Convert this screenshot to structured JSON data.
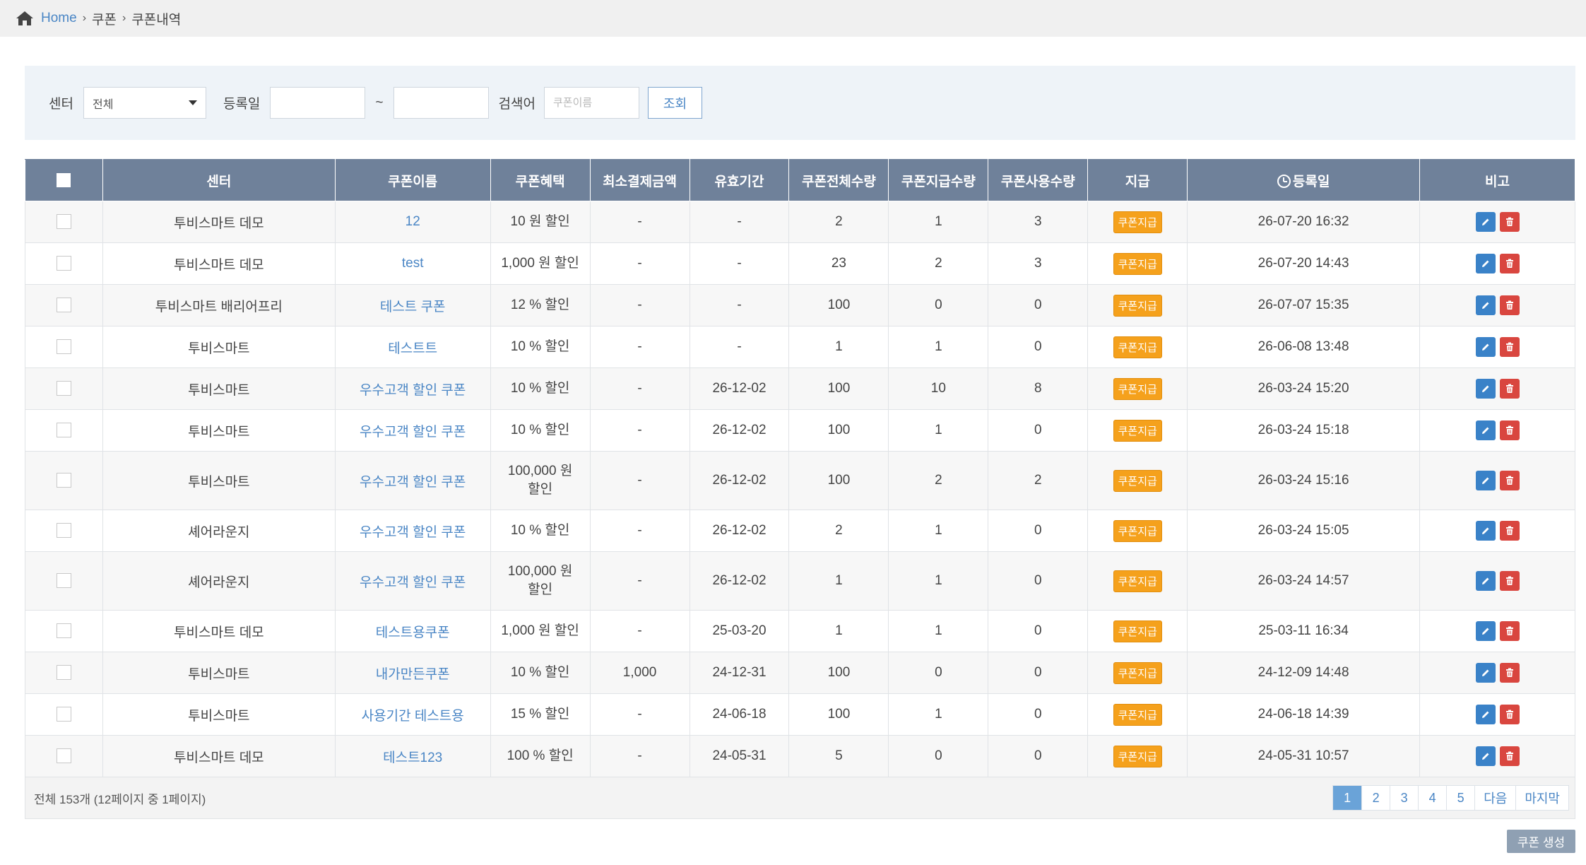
{
  "breadcrumb": {
    "home": "Home",
    "level1": "쿠폰",
    "level2": "쿠폰내역"
  },
  "filter": {
    "center_label": "센터",
    "center_value": "전체",
    "date_label": "등록일",
    "tilde": "~",
    "keyword_label": "검색어",
    "keyword_placeholder": "쿠폰이름",
    "search_button": "조회"
  },
  "table": {
    "headers": [
      "센터",
      "쿠폰이름",
      "쿠폰혜택",
      "최소결제금액",
      "유효기간",
      "쿠폰전체수량",
      "쿠폰지급수량",
      "쿠폰사용수량",
      "지급",
      "등록일",
      "비고"
    ],
    "issue_label": "쿠폰지급",
    "rows": [
      {
        "center": "투비스마트 데모",
        "name": "12",
        "benefit": "10 원 할인",
        "min": "-",
        "valid": "-",
        "total": "2",
        "issued": "1",
        "used": "3",
        "date": "26-07-20 16:32"
      },
      {
        "center": "투비스마트 데모",
        "name": "test",
        "benefit": "1,000 원 할인",
        "min": "-",
        "valid": "-",
        "total": "23",
        "issued": "2",
        "used": "3",
        "date": "26-07-20 14:43"
      },
      {
        "center": "투비스마트 배리어프리",
        "name": "테스트 쿠폰",
        "benefit": "12 % 할인",
        "min": "-",
        "valid": "-",
        "total": "100",
        "issued": "0",
        "used": "0",
        "date": "26-07-07 15:35"
      },
      {
        "center": "투비스마트",
        "name": "테스트트",
        "benefit": "10 % 할인",
        "min": "-",
        "valid": "-",
        "total": "1",
        "issued": "1",
        "used": "0",
        "date": "26-06-08 13:48"
      },
      {
        "center": "투비스마트",
        "name": "우수고객 할인 쿠폰",
        "benefit": "10 % 할인",
        "min": "-",
        "valid": "26-12-02",
        "total": "100",
        "issued": "10",
        "used": "8",
        "date": "26-03-24 15:20"
      },
      {
        "center": "투비스마트",
        "name": "우수고객 할인 쿠폰",
        "benefit": "10 % 할인",
        "min": "-",
        "valid": "26-12-02",
        "total": "100",
        "issued": "1",
        "used": "0",
        "date": "26-03-24 15:18"
      },
      {
        "center": "투비스마트",
        "name": "우수고객 할인 쿠폰",
        "benefit": "100,000 원 할인",
        "min": "-",
        "valid": "26-12-02",
        "total": "100",
        "issued": "2",
        "used": "2",
        "date": "26-03-24 15:16"
      },
      {
        "center": "셰어라운지",
        "name": "우수고객 할인 쿠폰",
        "benefit": "10 % 할인",
        "min": "-",
        "valid": "26-12-02",
        "total": "2",
        "issued": "1",
        "used": "0",
        "date": "26-03-24 15:05"
      },
      {
        "center": "셰어라운지",
        "name": "우수고객 할인 쿠폰",
        "benefit": "100,000 원 할인",
        "min": "-",
        "valid": "26-12-02",
        "total": "1",
        "issued": "1",
        "used": "0",
        "date": "26-03-24 14:57"
      },
      {
        "center": "투비스마트 데모",
        "name": "테스트용쿠폰",
        "benefit": "1,000 원 할인",
        "min": "-",
        "valid": "25-03-20",
        "total": "1",
        "issued": "1",
        "used": "0",
        "date": "25-03-11 16:34"
      },
      {
        "center": "투비스마트",
        "name": "내가만든쿠폰",
        "benefit": "10 % 할인",
        "min": "1,000",
        "valid": "24-12-31",
        "total": "100",
        "issued": "0",
        "used": "0",
        "date": "24-12-09 14:48"
      },
      {
        "center": "투비스마트",
        "name": "사용기간 테스트용",
        "benefit": "15 % 할인",
        "min": "-",
        "valid": "24-06-18",
        "total": "100",
        "issued": "1",
        "used": "0",
        "date": "24-06-18 14:39"
      },
      {
        "center": "투비스마트 데모",
        "name": "테스트123",
        "benefit": "100 % 할인",
        "min": "-",
        "valid": "24-05-31",
        "total": "5",
        "issued": "0",
        "used": "0",
        "date": "24-05-31 10:57"
      }
    ]
  },
  "footer": {
    "summary": "전체 153개 (12페이지 중 1페이지)",
    "pages": [
      "1",
      "2",
      "3",
      "4",
      "5"
    ],
    "next": "다음",
    "last": "마지막"
  },
  "create_button": "쿠폰 생성"
}
